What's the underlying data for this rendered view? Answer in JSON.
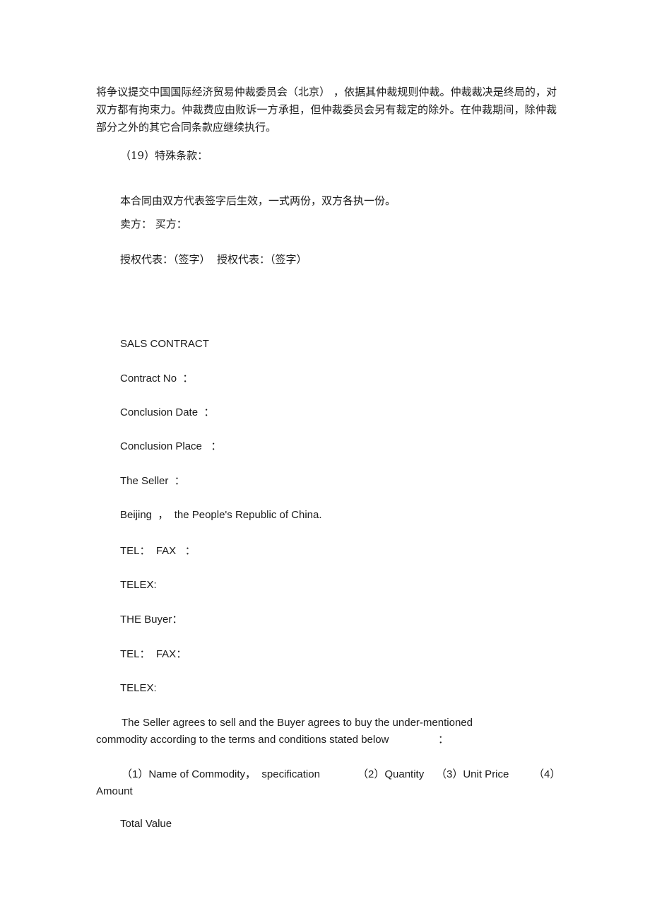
{
  "document": {
    "type": "bilingual-sales-contract",
    "background_color": "#ffffff",
    "text_color": "#1a1a1a"
  },
  "chinese_section": {
    "arbitration_paragraph": "将争议提交中国国际经济贸易仲裁委员会（北京） ，依据其仲裁规则仲裁。仲裁裁决是终局的，对双方都有拘束力。仲裁费应由败诉一方承担，但仲裁委员会另有裁定的除外。在仲裁期间，除仲裁部分之外的其它合同条款应继续执行。",
    "clause_19_heading": "（19）特殊条款：",
    "effect_clause": "本合同由双方代表签字后生效，一式两份，双方各执一份。",
    "parties_line": "卖方： 买方：",
    "signature_line": "授权代表：（签字）  授权代表：（签字）"
  },
  "english_section": {
    "title": "SALS CONTRACT",
    "fields": [
      {
        "label": "Contract No",
        "separator": "：",
        "value": ""
      },
      {
        "label": "Conclusion Date",
        "separator": "：",
        "value": ""
      },
      {
        "label": "Conclusion Place",
        "separator": "：",
        "value": ""
      },
      {
        "label": "The Seller",
        "separator": "：",
        "value": ""
      }
    ],
    "contract_no_line": "Contract No  ：",
    "conclusion_date_line": "Conclusion Date  ：",
    "conclusion_place_line": "Conclusion Place   ：",
    "the_seller_line": "The Seller  ：",
    "seller_address_line": "Beijing  ，  the People's Republic of China.",
    "seller_tel_fax_line": "TEL：  FAX   ：",
    "seller_telex_line": "TELEX:",
    "the_buyer_line": "THE Buyer：",
    "buyer_tel_fax_line": "TEL：  FAX：",
    "buyer_telex_line": "TELEX:",
    "agreement_paragraph_line1": "The Seller agrees to sell and the Buyer agrees to buy the under-mentioned",
    "agreement_paragraph_line2": "commodity according to the terms and conditions stated below",
    "agreement_paragraph_colon": "：",
    "columns_line_1": "（1）Name of Commodity，  specification",
    "columns_line_2": "（2）Quantity",
    "columns_line_3": "（3）Unit Price",
    "columns_line_4": "（4）",
    "columns_wrap": "Amount",
    "total_value_line": "Total Value"
  }
}
